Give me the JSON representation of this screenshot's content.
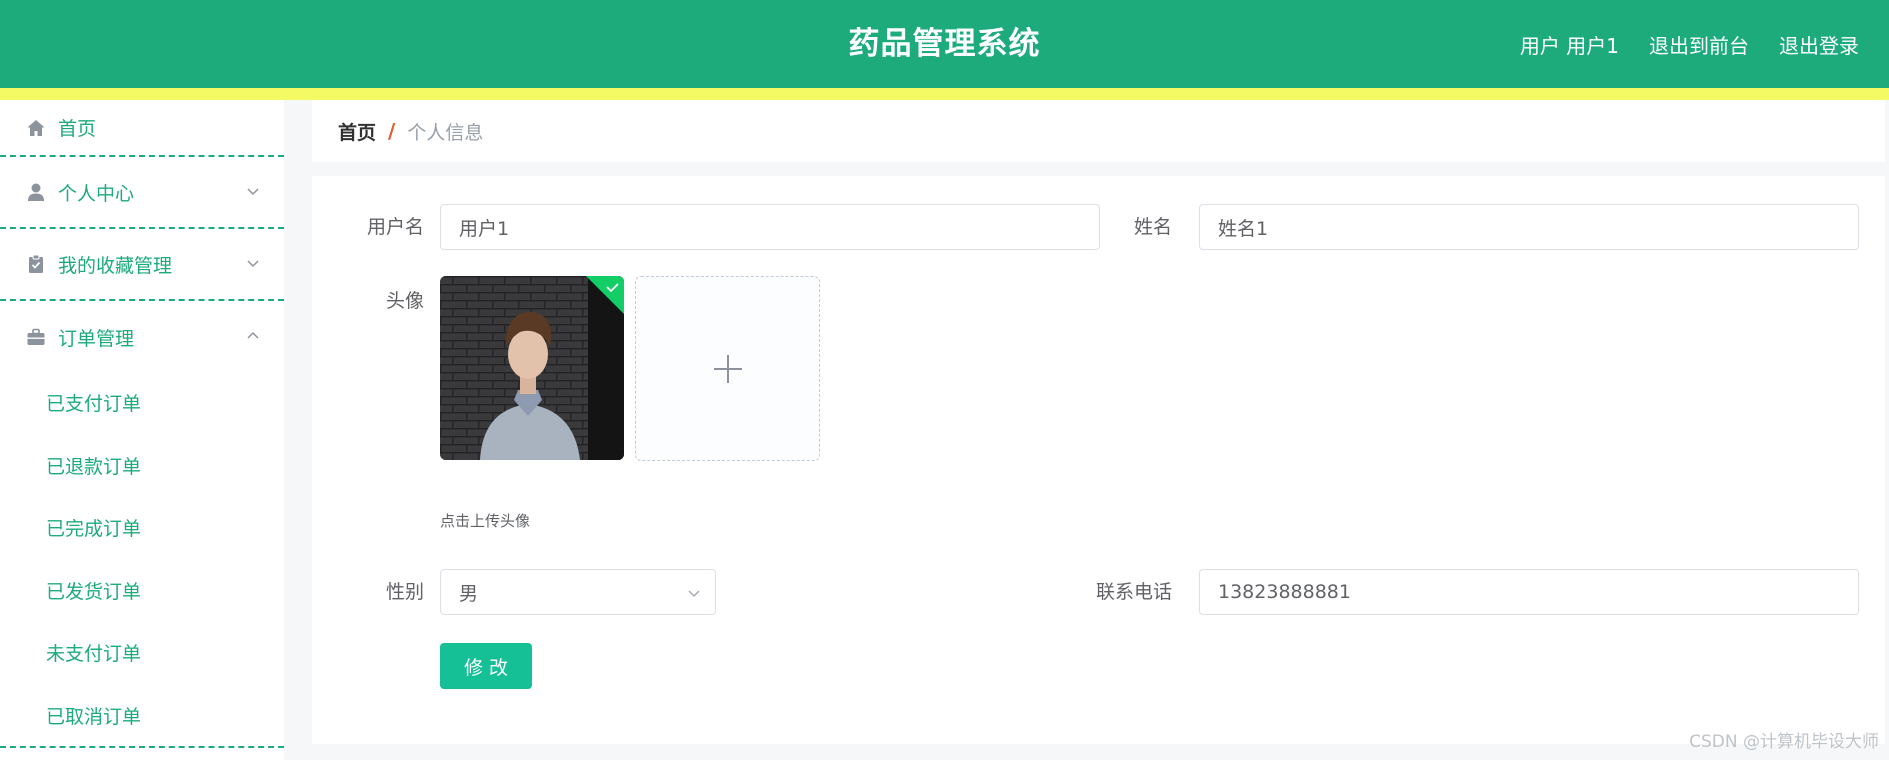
{
  "header": {
    "title": "药品管理系统",
    "user_label": "用户 用户1",
    "front_label": "退出到前台",
    "logout_label": "退出登录"
  },
  "sidebar": {
    "items": [
      {
        "label": "首页",
        "icon": "home-icon"
      },
      {
        "label": "个人中心",
        "icon": "user-icon",
        "expanded": false
      },
      {
        "label": "我的收藏管理",
        "icon": "clipboard-icon",
        "expanded": false
      },
      {
        "label": "订单管理",
        "icon": "briefcase-icon",
        "expanded": true,
        "children": [
          "已支付订单",
          "已退款订单",
          "已完成订单",
          "已发货订单",
          "未支付订单",
          "已取消订单"
        ]
      }
    ]
  },
  "breadcrumb": {
    "home": "首页",
    "separator": "/",
    "current": "个人信息"
  },
  "form": {
    "username_label": "用户名",
    "username_value": "用户1",
    "name_label": "姓名",
    "name_value": "姓名1",
    "avatar_label": "头像",
    "upload_hint": "点击上传头像",
    "gender_label": "性别",
    "gender_value": "男",
    "phone_label": "联系电话",
    "phone_value": "13823888881",
    "submit_label": "修改"
  },
  "watermark": "CSDN @计算机毕设大师",
  "colors": {
    "primary": "#1dab7c",
    "stripe": "#f4fa63",
    "button": "#16c096",
    "breadcrumb_separator": "#e45a2b"
  }
}
